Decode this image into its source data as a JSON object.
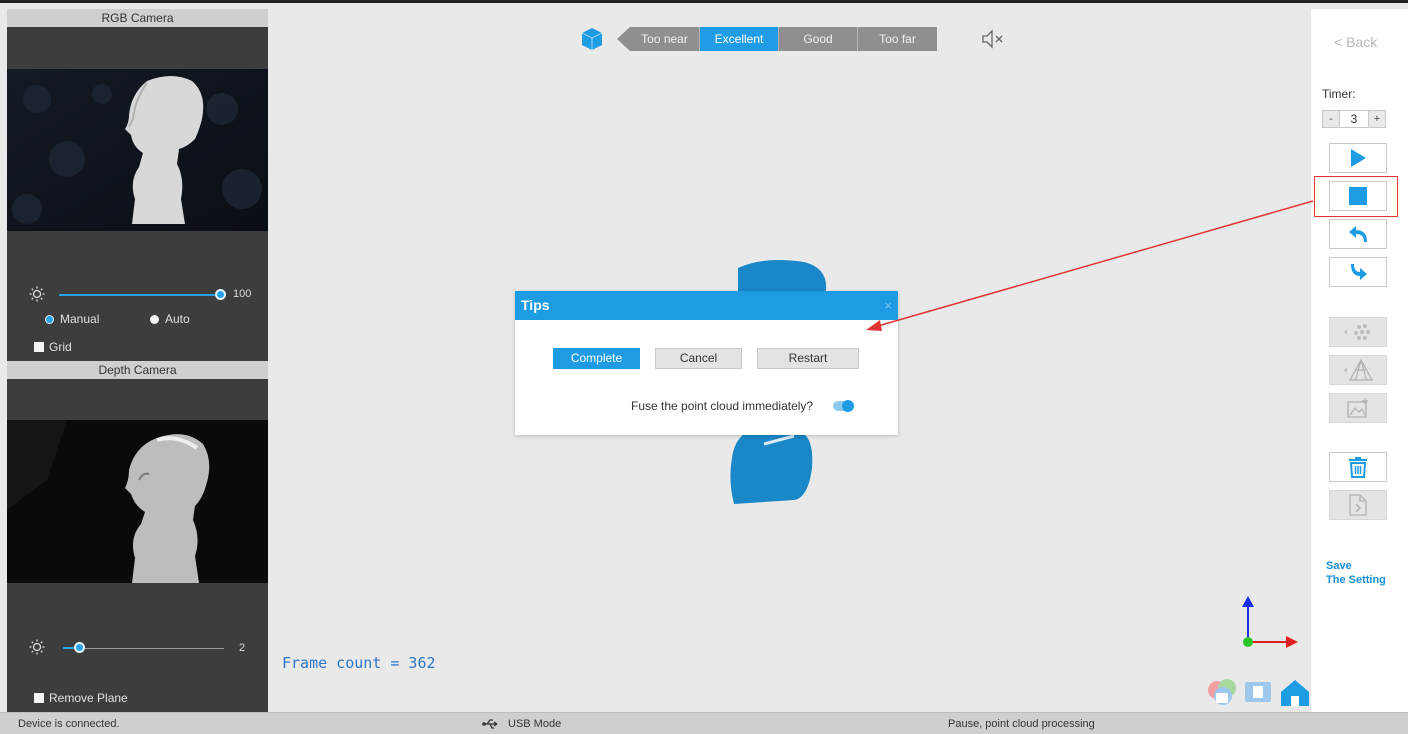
{
  "left_panel": {
    "rgb_title": "RGB Camera",
    "brightness_value": "100",
    "brightness_level": 1.0,
    "manual_label": "Manual",
    "auto_label": "Auto",
    "grid_label": "Grid",
    "depth_title": "Depth Camera",
    "depth_value": "2",
    "remove_plane_label": "Remove Plane"
  },
  "quality_bar": {
    "segments": [
      "Too near",
      "Excellent",
      "Good",
      "Too far"
    ],
    "active": "Excellent"
  },
  "canvas": {
    "frame_count": "Frame count = 362"
  },
  "dialog": {
    "title": "Tips",
    "close": "×",
    "complete_label": "Complete",
    "cancel_label": "Cancel",
    "restart_label": "Restart",
    "fuse_label": "Fuse the point cloud immediately?",
    "fuse_enabled": true
  },
  "right_panel": {
    "back_label": "< Back",
    "timer_label": "Timer:",
    "timer_minus": "-",
    "timer_value": "3",
    "timer_plus": "+",
    "icons": [
      "play-icon",
      "stop-icon",
      "undo-icon",
      "redo-icon",
      "point-cloud-icon",
      "mesh-icon",
      "add-texture-icon",
      "trash-icon",
      "export-file-icon"
    ],
    "save_line1": "Save",
    "save_line2": "The Setting"
  },
  "status_bar": {
    "connection": "Device is connected.",
    "mode": "USB Mode",
    "state": "Pause, point cloud processing"
  },
  "colors": {
    "accent": "#1d9be3",
    "annotation": "#e03535",
    "panel_dark": "#3d3d3d"
  }
}
